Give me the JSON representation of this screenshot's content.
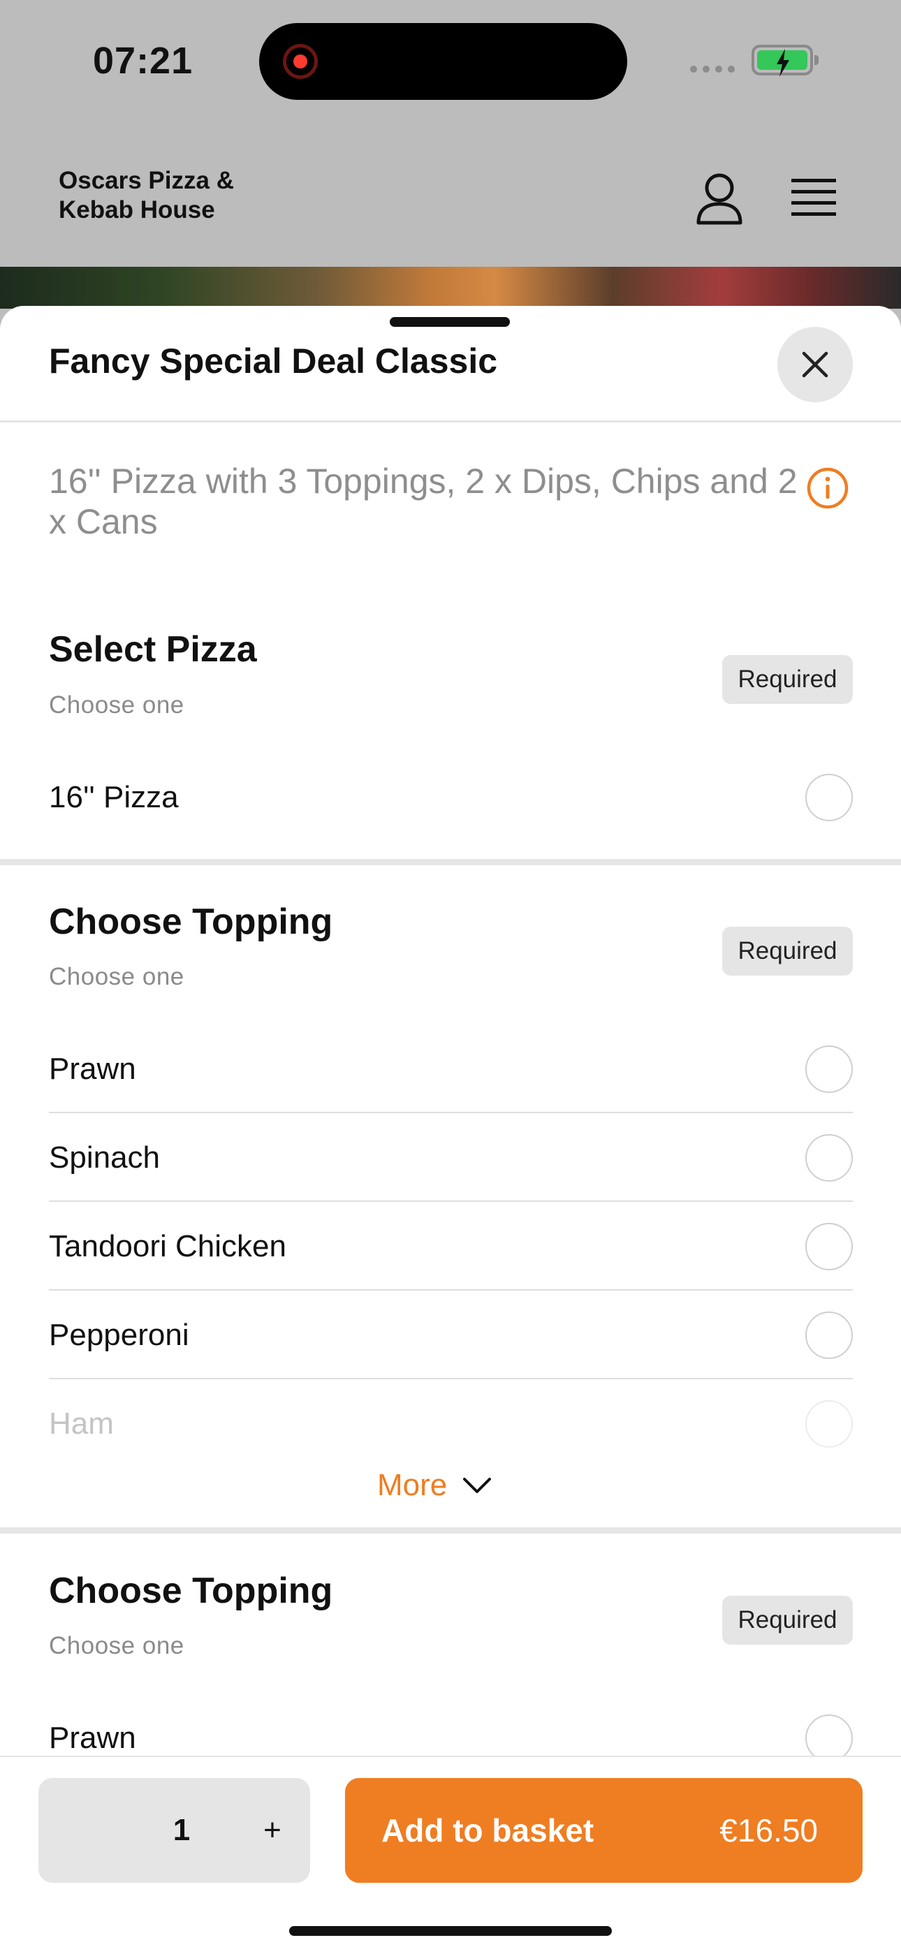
{
  "status_bar": {
    "time": "07:21"
  },
  "header": {
    "brand_line1": "Oscars Pizza &",
    "brand_line2": "Kebab House",
    "user_icon": "user-icon",
    "menu_icon": "hamburger-menu-icon"
  },
  "sheet": {
    "title": "Fancy Special Deal Classic",
    "description": "16'' Pizza with 3 Toppings, 2 x Dips, Chips and 2 x Cans",
    "sections": [
      {
        "title": "Select Pizza",
        "subtitle": "Choose one",
        "badge": "Required",
        "options": [
          "16'' Pizza"
        ]
      },
      {
        "title": "Choose Topping",
        "subtitle": "Choose one",
        "badge": "Required",
        "options": [
          "Prawn",
          "Spinach",
          "Tandoori Chicken",
          "Pepperoni",
          "Ham"
        ],
        "more_label": "More"
      },
      {
        "title": "Choose Topping",
        "subtitle": "Choose one",
        "badge": "Required",
        "options": [
          "Prawn"
        ]
      }
    ]
  },
  "footer": {
    "quantity": "1",
    "plus_label": "+",
    "add_label": "Add to basket",
    "price": "€16.50"
  },
  "colors": {
    "accent": "#ef7d22",
    "badge_bg": "#e5e5e5",
    "battery": "#34c759",
    "record": "#ff3b30"
  }
}
